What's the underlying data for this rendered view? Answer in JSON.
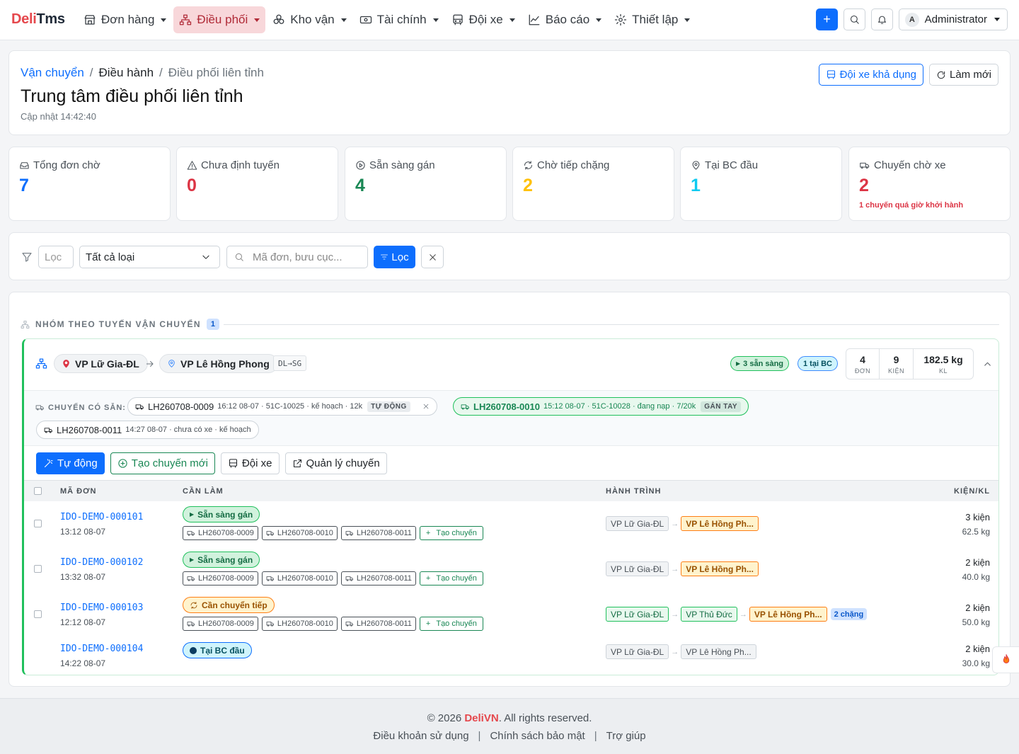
{
  "brand": {
    "part1": "Deli",
    "part2": "Tms"
  },
  "nav": [
    {
      "label": "Đơn hàng",
      "icon": "store-icon"
    },
    {
      "label": "Điều phối",
      "icon": "sitemap-icon"
    },
    {
      "label": "Kho vận",
      "icon": "boxes-icon"
    },
    {
      "label": "Tài chính",
      "icon": "cash-icon"
    },
    {
      "label": "Đội xe",
      "icon": "bus-icon"
    },
    {
      "label": "Báo cáo",
      "icon": "chart-line-icon"
    },
    {
      "label": "Thiết lập",
      "icon": "gear-icon"
    }
  ],
  "user": {
    "initial": "A",
    "name": "Administrator"
  },
  "header": {
    "breadcrumb": [
      "Vận chuyển",
      "Điều hành",
      "Điều phối liên tỉnh"
    ],
    "sep": "/",
    "title": "Trung tâm điều phối liên tỉnh",
    "updated": "Cập nhật 14:42:40",
    "btn_fleet": "Đội xe khả dụng",
    "btn_refresh": "Làm mới"
  },
  "stats": [
    {
      "label": "Tổng đơn chờ",
      "value": "7",
      "color": "#0d6efd",
      "icon": "inbox-icon",
      "note": ""
    },
    {
      "label": "Chưa định tuyến",
      "value": "0",
      "color": "#dc3545",
      "icon": "warning-icon",
      "note": ""
    },
    {
      "label": "Sẵn sàng gán",
      "value": "4",
      "color": "#198754",
      "icon": "play-circle-icon",
      "note": ""
    },
    {
      "label": "Chờ tiếp chặng",
      "value": "2",
      "color": "#ffc107",
      "icon": "refresh-icon",
      "note": ""
    },
    {
      "label": "Tại BC đầu",
      "value": "1",
      "color": "#0dcaf0",
      "icon": "pin-icon",
      "note": ""
    },
    {
      "label": "Chuyến chờ xe",
      "value": "2",
      "color": "#dc3545",
      "icon": "truck-icon",
      "note": "1 chuyến quá giờ khởi hành"
    }
  ],
  "filter": {
    "placeholder_small": "Lọc",
    "type_select": "Tất cả loại",
    "search_placeholder": "Mã đơn, bưu cục...",
    "btn_filter": "Lọc"
  },
  "group": {
    "title": "NHÓM THEO TUYẾN VẬN CHUYỂN",
    "count": "1"
  },
  "route": {
    "from": "VP Lữ Gia-ĐL",
    "to": "VP Lê Hồng Phong",
    "code": "DL→SG",
    "badge_ready": "3 sẵn sàng",
    "badge_bc": "1 tại BC",
    "summary": [
      {
        "value": "4",
        "unit": "ĐƠN"
      },
      {
        "value": "9",
        "unit": "KIỆN"
      },
      {
        "value": "182.5 kg",
        "unit": "KL"
      }
    ]
  },
  "trips_label": "CHUYẾN CÓ SẴN:",
  "trips": [
    {
      "code": "LH260708-0009",
      "meta": "16:12 08-07 · 51C-10025 · kế hoạch · 12k",
      "tag": "TỰ ĐỘNG"
    },
    {
      "code": "LH260708-0010",
      "meta": "15:12 08-07 · 51C-10028 · đang nạp · 7/20k",
      "tag": "GÁN TAY"
    },
    {
      "code": "LH260708-0011",
      "meta": "14:27 08-07 · chưa có xe · kế hoạch",
      "tag": ""
    }
  ],
  "actions": {
    "auto": "Tự động",
    "create": "Tạo chuyến mới",
    "fleet": "Đội xe",
    "manage": "Quản lý chuyến"
  },
  "table": {
    "col_id": "MÃ ĐƠN",
    "col_todo": "CẦN LÀM",
    "col_journey": "HÀNH TRÌNH",
    "col_qty": "KIỆN/KL"
  },
  "trip_codes": [
    "LH260708-0009",
    "LH260708-0010",
    "LH260708-0011"
  ],
  "create_trip_label": "Tạo chuyến",
  "orders": [
    {
      "id": "IDO-DEMO-000101",
      "time": "13:12 08-07",
      "status": "Sẵn sàng gán",
      "journey": [
        "VP Lữ Gia-ĐL",
        "VP Lê Hồng Ph..."
      ],
      "legs": "",
      "pieces": "3 kiện",
      "weight": "62.5 kg"
    },
    {
      "id": "IDO-DEMO-000102",
      "time": "13:32 08-07",
      "status": "Sẵn sàng gán",
      "journey": [
        "VP Lữ Gia-ĐL",
        "VP Lê Hồng Ph..."
      ],
      "legs": "",
      "pieces": "2 kiện",
      "weight": "40.0 kg"
    },
    {
      "id": "IDO-DEMO-000103",
      "time": "12:12 08-07",
      "status": "Cần chuyển tiếp",
      "journey": [
        "VP Lữ Gia-ĐL",
        "VP Thủ Đức",
        "VP Lê Hồng Ph..."
      ],
      "legs": "2 chặng",
      "pieces": "2 kiện",
      "weight": "50.0 kg"
    },
    {
      "id": "IDO-DEMO-000104",
      "time": "14:22 08-07",
      "status": "Tại BC đầu",
      "journey": [
        "VP Lữ Gia-ĐL",
        "VP Lê Hồng Ph..."
      ],
      "legs": "",
      "pieces": "2 kiện",
      "weight": "30.0 kg"
    }
  ],
  "footer": {
    "copy_pre": "© 2026",
    "copy_brand": "DeliVN",
    "copy_post": ". All rights reserved.",
    "links": [
      "Điều khoản sử dụng",
      "Chính sách bảo mật",
      "Trợ giúp"
    ]
  }
}
